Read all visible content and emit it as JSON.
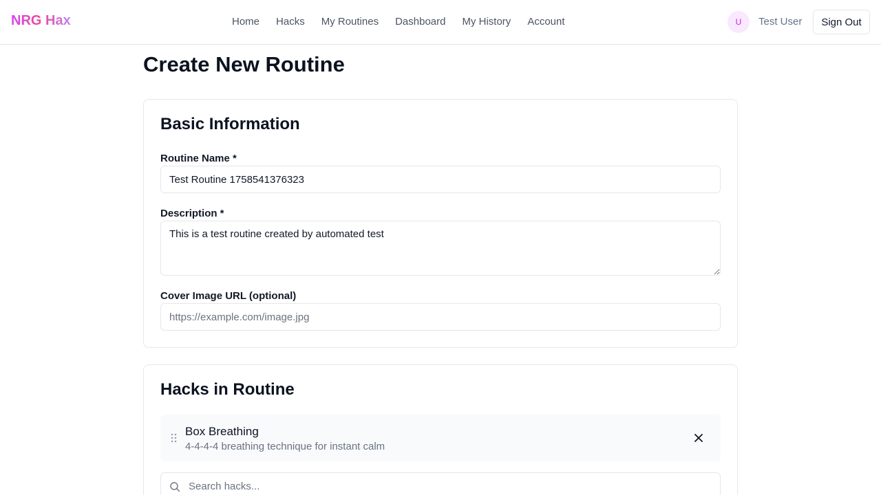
{
  "nav": {
    "brand": "NRG Hax",
    "links": [
      "Home",
      "Hacks",
      "My Routines",
      "Dashboard",
      "My History",
      "Account"
    ],
    "avatar_initial": "U",
    "user_name": "Test User",
    "sign_out_label": "Sign Out"
  },
  "page": {
    "title": "Create New Routine"
  },
  "basic_info": {
    "heading": "Basic Information",
    "name_label": "Routine Name *",
    "name_value": "Test Routine 1758541376323",
    "description_label": "Description *",
    "description_value": "This is a test routine created by automated test",
    "cover_label": "Cover Image URL (optional)",
    "cover_placeholder": "https://example.com/image.jpg"
  },
  "hacks": {
    "heading": "Hacks in Routine",
    "items": [
      {
        "name": "Box Breathing",
        "description": "4-4-4-4 breathing technique for instant calm"
      }
    ],
    "search_placeholder": "Search hacks..."
  },
  "colors": {
    "brand_gradient": [
      "#d946ef",
      "#ec4899",
      "#c084fc"
    ],
    "border": "#e5e7eb",
    "muted_text": "#6b7280"
  },
  "icons": [
    "drag-handle-icon",
    "close-icon",
    "search-icon"
  ]
}
